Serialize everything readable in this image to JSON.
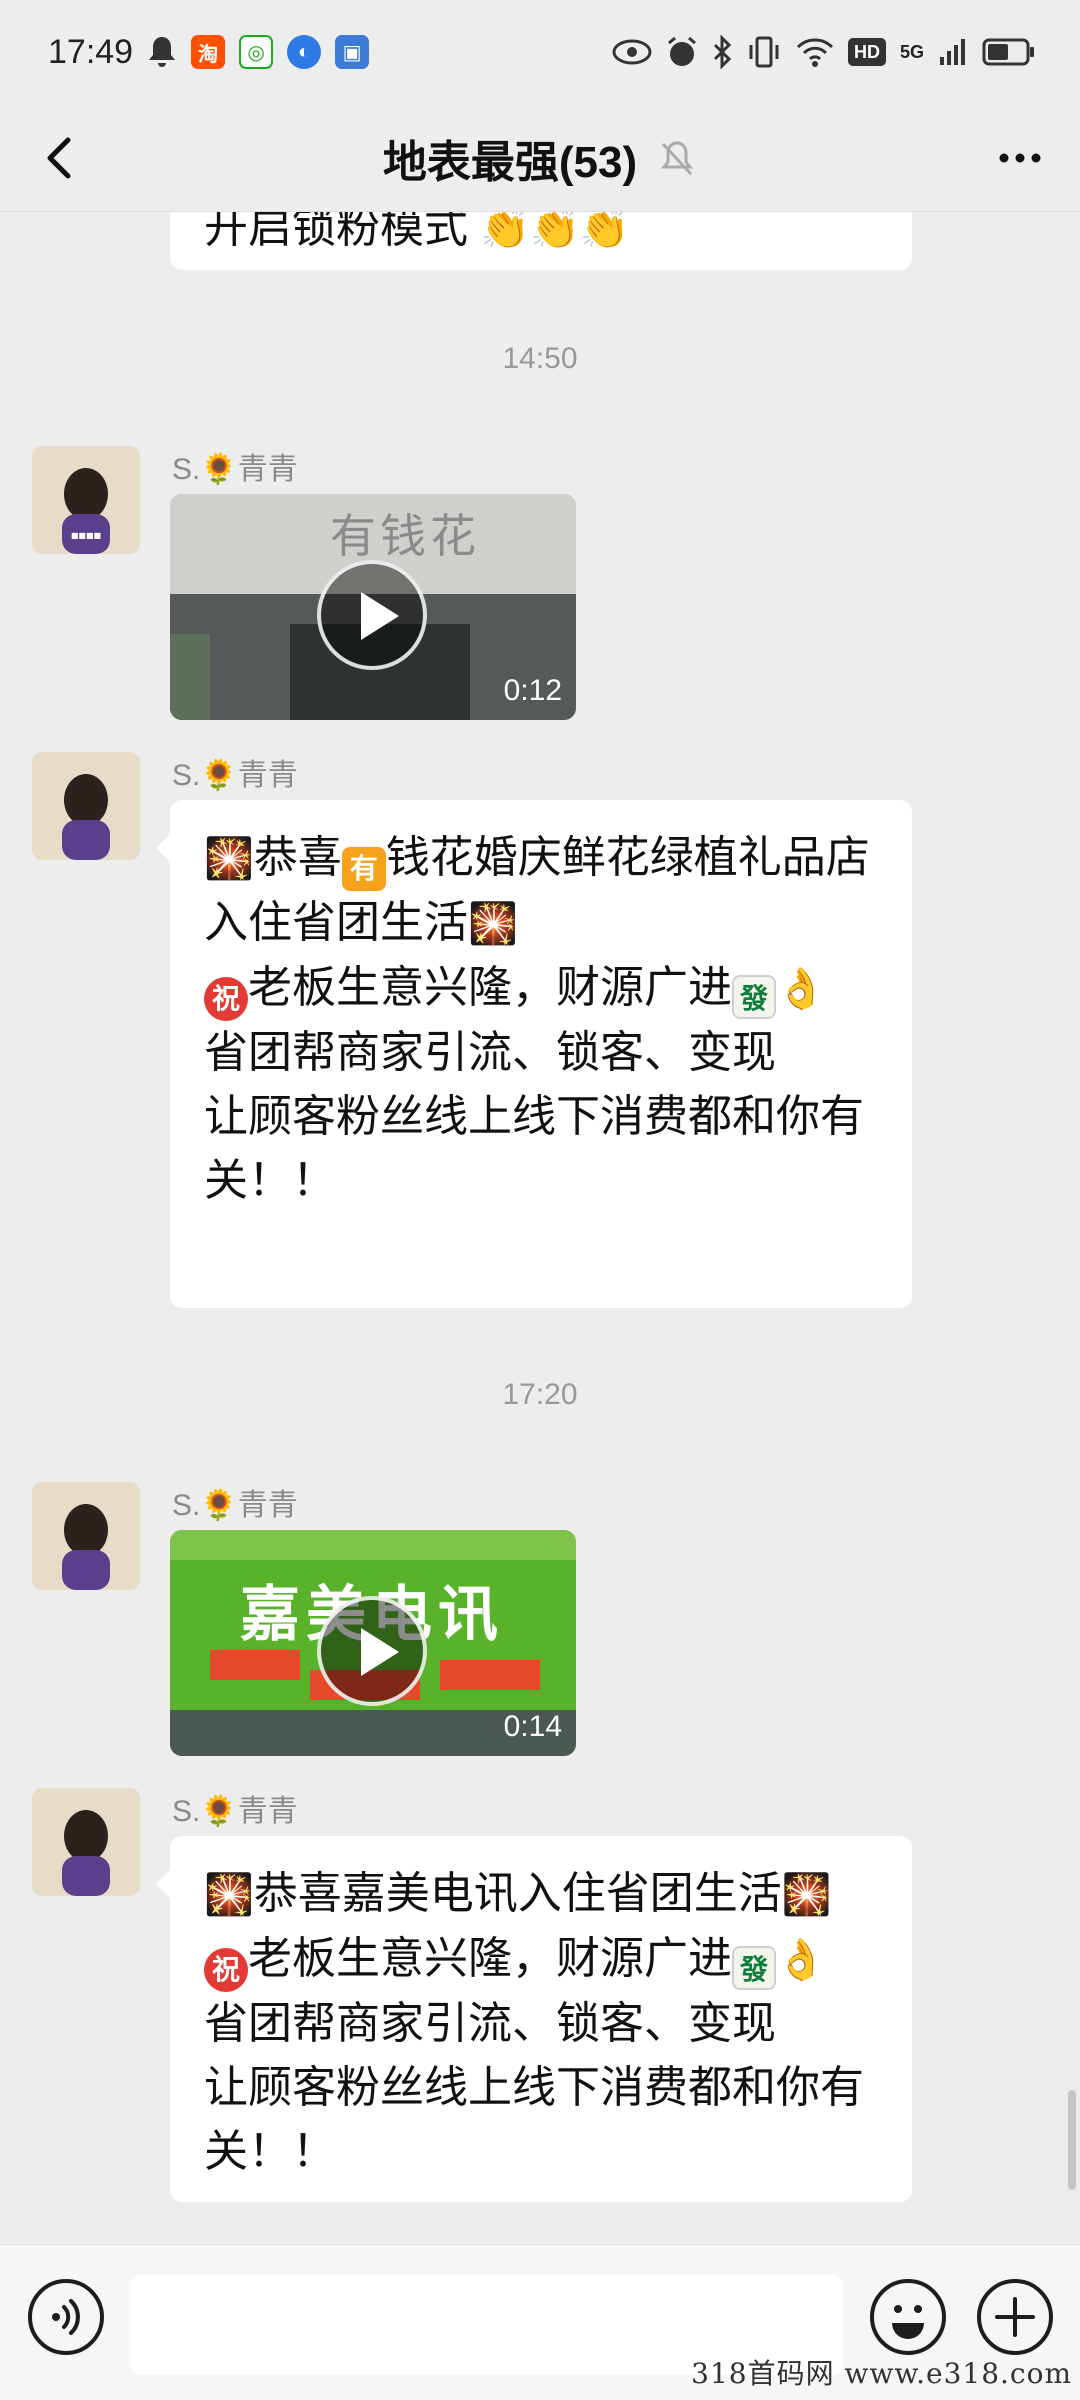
{
  "status_bar": {
    "time": "17:49",
    "network": "5G",
    "hd_label": "HD"
  },
  "nav": {
    "title": "地表最强(53)"
  },
  "chat": {
    "partial_top_text": "开启锁粉模式",
    "time_1": "14:50",
    "sender": "S.🌻青青",
    "video_1": {
      "sign_text": "有钱花",
      "duration": "0:12"
    },
    "msg_1": {
      "line_1a": "恭喜",
      "line_1b": "钱花婚庆鲜花绿植礼品店",
      "line_2": "入住省团生活",
      "line_3": "老板生意兴隆，财源广进",
      "line_4": "省团帮商家引流、锁客、变现",
      "line_5": "让顾客粉丝线上线下消费都和你有关！！",
      "emoji_you": "有",
      "emoji_zhu": "祝",
      "emoji_fa": "發"
    },
    "time_2": "17:20",
    "video_2": {
      "sign_text": "嘉美电讯",
      "duration": "0:14"
    },
    "msg_2": {
      "line_1": "恭喜嘉美电讯入住省团生活",
      "line_2": "老板生意兴隆，财源广进",
      "line_3": "省团帮商家引流、锁客、变现",
      "line_4": "让顾客粉丝线上线下消费都和你有关！！",
      "emoji_zhu": "祝",
      "emoji_fa": "發"
    }
  },
  "input": {
    "value": ""
  },
  "watermark": "318首码网 www.e318.com"
}
